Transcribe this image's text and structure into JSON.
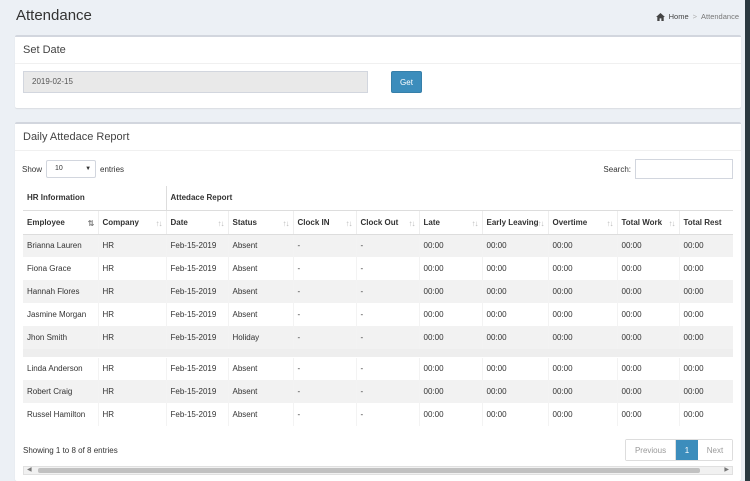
{
  "header": {
    "title": "Attendance"
  },
  "breadcrumb": {
    "home": "Home",
    "sep": ">",
    "current": "Attendance"
  },
  "set_date": {
    "title": "Set Date",
    "date_value": "2019-02-15",
    "get_label": "Get"
  },
  "report": {
    "title": "Daily Attedace Report",
    "show_label": "Show",
    "entries_value": "10",
    "entries_label": "entries",
    "search_label": "Search:",
    "group_headers": {
      "hr": "HR Information",
      "att": "Attedace Report"
    },
    "columns": [
      "Employee",
      "Company",
      "Date",
      "Status",
      "Clock IN",
      "Clock Out",
      "Late",
      "Early Leaving",
      "Overtime",
      "Total Work",
      "Total Rest"
    ],
    "rows": [
      [
        "Brianna Lauren",
        "HR",
        "Feb-15-2019",
        "Absent",
        "-",
        "-",
        "00:00",
        "00:00",
        "00:00",
        "00:00",
        "00:00"
      ],
      [
        "Fiona Grace",
        "HR",
        "Feb-15-2019",
        "Absent",
        "-",
        "-",
        "00:00",
        "00:00",
        "00:00",
        "00:00",
        "00:00"
      ],
      [
        "Hannah Flores",
        "HR",
        "Feb-15-2019",
        "Absent",
        "-",
        "-",
        "00:00",
        "00:00",
        "00:00",
        "00:00",
        "00:00"
      ],
      [
        "Jasmine Morgan",
        "HR",
        "Feb-15-2019",
        "Absent",
        "-",
        "-",
        "00:00",
        "00:00",
        "00:00",
        "00:00",
        "00:00"
      ],
      [
        "Jhon Smith",
        "HR",
        "Feb-15-2019",
        "Holiday",
        "-",
        "-",
        "00:00",
        "00:00",
        "00:00",
        "00:00",
        "00:00"
      ],
      [
        "Linda Anderson",
        "HR",
        "Feb-15-2019",
        "Absent",
        "-",
        "-",
        "00:00",
        "00:00",
        "00:00",
        "00:00",
        "00:00"
      ],
      [
        "Robert Craig",
        "HR",
        "Feb-15-2019",
        "Absent",
        "-",
        "-",
        "00:00",
        "00:00",
        "00:00",
        "00:00",
        "00:00"
      ],
      [
        "Russel Hamilton",
        "HR",
        "Feb-15-2019",
        "Absent",
        "-",
        "-",
        "00:00",
        "00:00",
        "00:00",
        "00:00",
        "00:00"
      ]
    ],
    "info": "Showing 1 to 8 of 8 entries",
    "pager": {
      "prev": "Previous",
      "current": "1",
      "next": "Next"
    }
  },
  "colors": {
    "primary": "#3c8dbc",
    "background": "#ecf0f5"
  }
}
